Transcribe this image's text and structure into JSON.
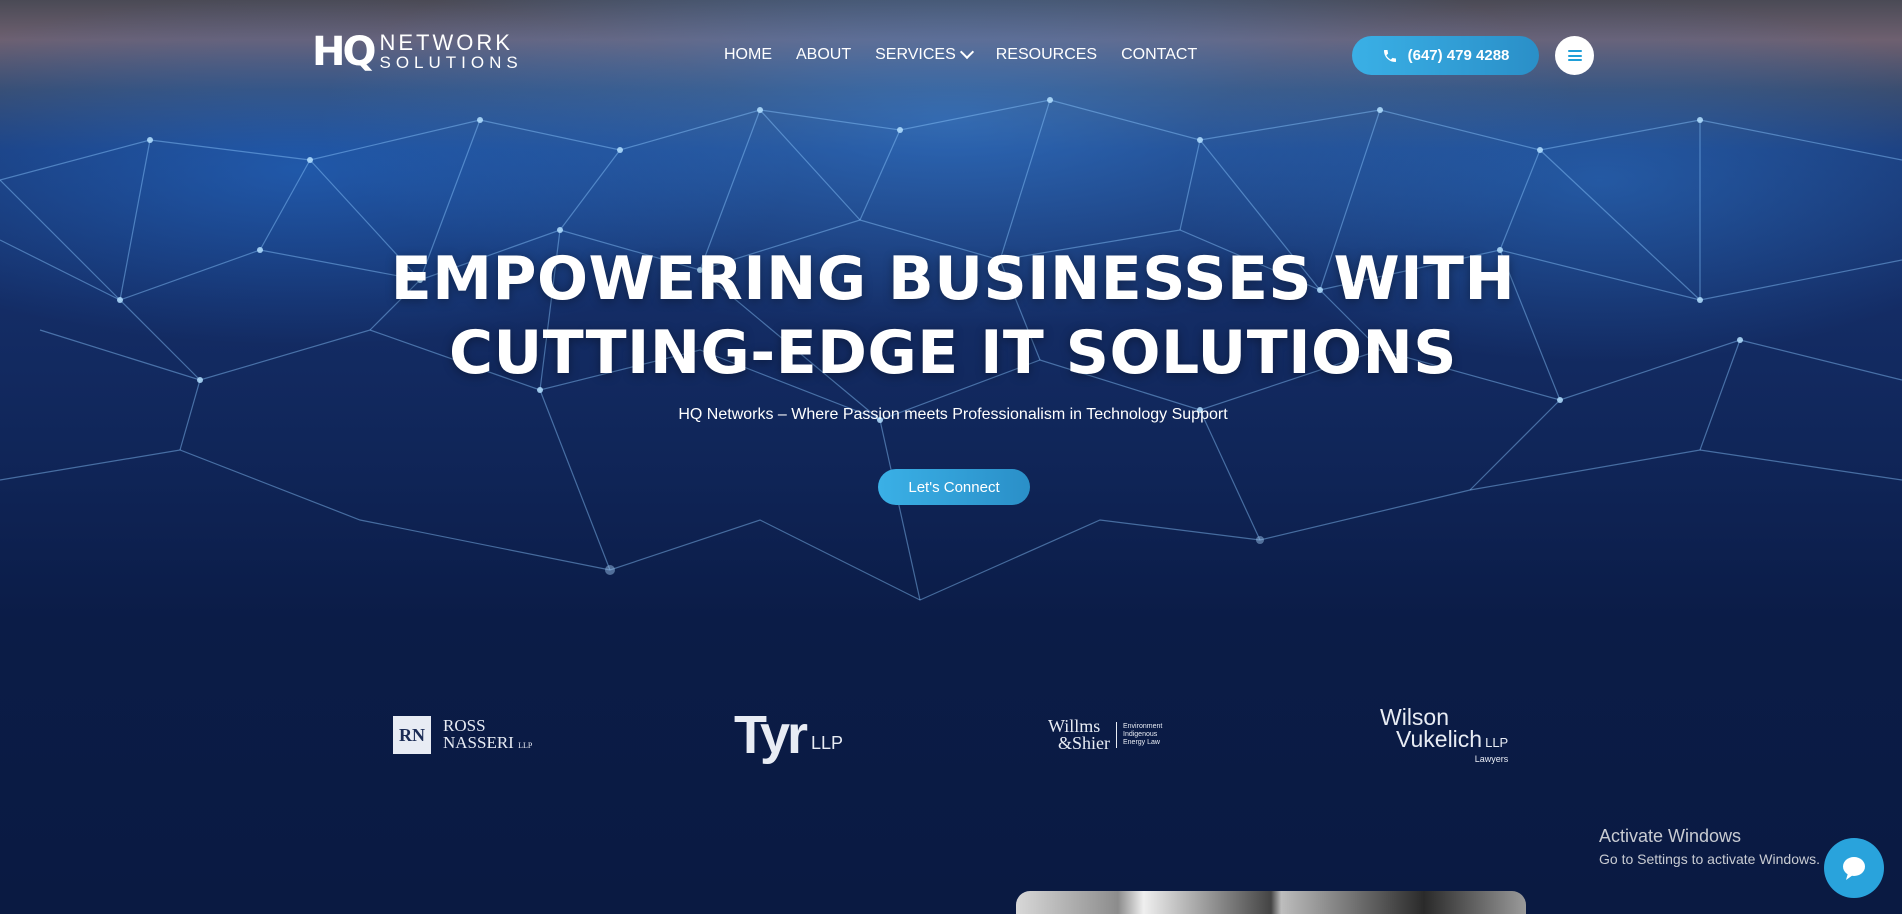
{
  "brand": {
    "mark": "HQ",
    "line1": "NETWORK",
    "line2": "SOLUTIONS"
  },
  "nav": {
    "items": [
      {
        "label": "HOME"
      },
      {
        "label": "ABOUT"
      },
      {
        "label": "SERVICES"
      },
      {
        "label": "RESOURCES"
      },
      {
        "label": "CONTACT"
      }
    ]
  },
  "header": {
    "phone": "(647) 479 4288",
    "phone_icon": "phone-icon",
    "menu_icon": "hamburger-icon"
  },
  "hero": {
    "headline_line1": "EMPOWERING BUSINESSES WITH",
    "headline_line2": "CUTTING-EDGE IT SOLUTIONS",
    "subline": "HQ Networks – Where Passion meets Professionalism in Technology Support",
    "cta": "Let's Connect"
  },
  "clients": {
    "ross_nasseri": {
      "monogram": "RN",
      "line1": "ROSS",
      "line2": "NASSERI",
      "suffix": "LLP"
    },
    "tyr": {
      "name": "Tyr",
      "suffix": "LLP"
    },
    "willms_shier": {
      "line1": "Willms",
      "line2": "&Shier",
      "tag1": "Environment",
      "tag2": "Indigenous",
      "tag3": "Energy Law"
    },
    "wilson_vukelich": {
      "line1": "Wilson",
      "line2": "Vukelich",
      "suffix": "LLP",
      "tag": "Lawyers"
    }
  },
  "os_overlay": {
    "title": "Activate Windows",
    "subtitle": "Go to Settings to activate Windows."
  },
  "chat": {
    "icon": "chat-bubble-icon"
  },
  "colors": {
    "accent": "#29a3dc",
    "background": "#0a1a42"
  }
}
